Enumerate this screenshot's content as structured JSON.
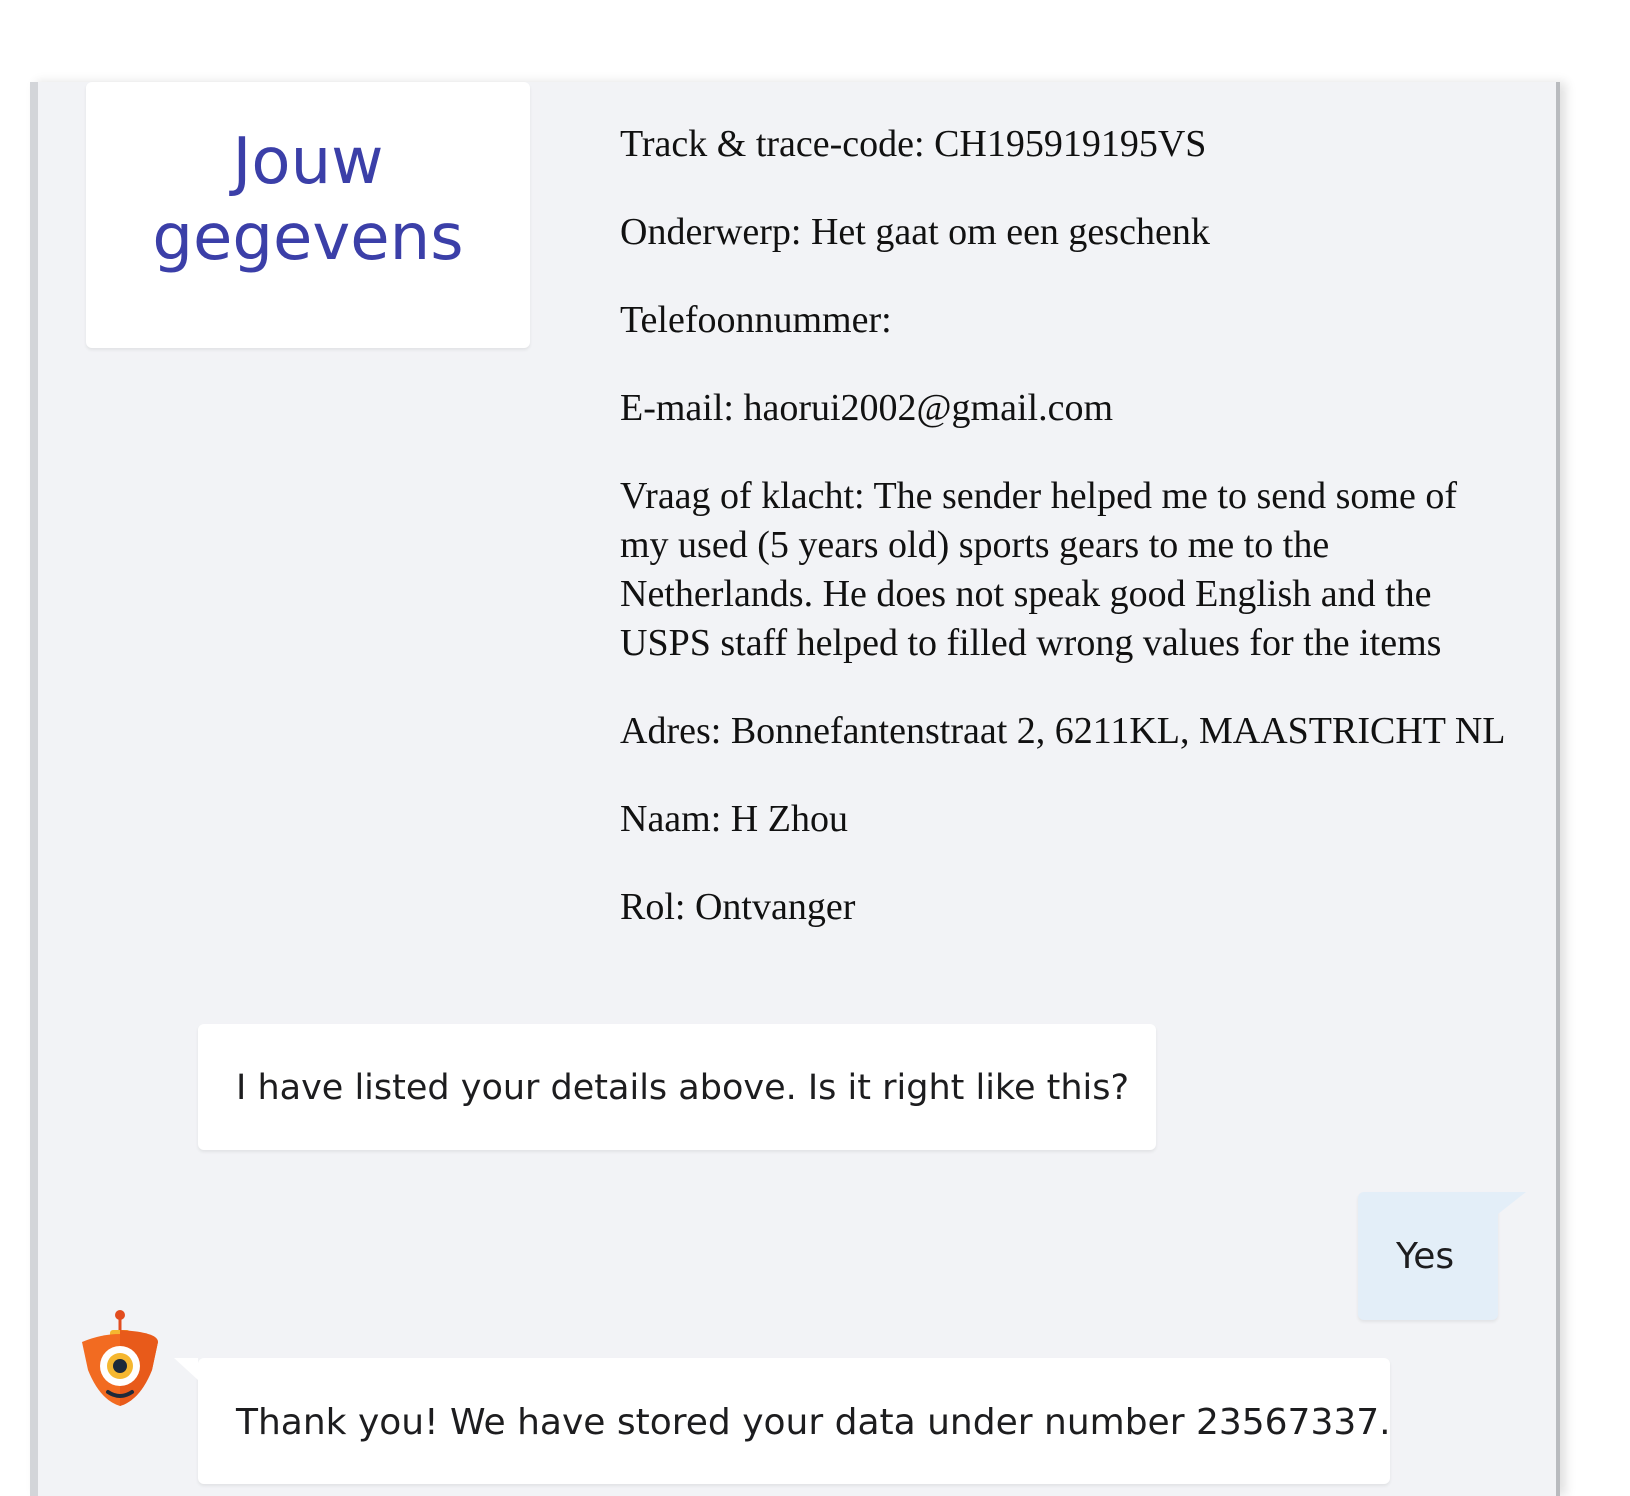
{
  "details": {
    "title": "Jouw gegevens",
    "fields": [
      {
        "label": "Track & trace-code:",
        "value": "CH195919195VS"
      },
      {
        "label": "Onderwerp:",
        "value": "Het gaat om een geschenk"
      },
      {
        "label": "Telefoonnummer:",
        "value": ""
      },
      {
        "label": "E-mail:",
        "value": "haorui2002@gmail.com"
      },
      {
        "label": "Vraag of klacht:",
        "value": "The sender helped me to send some of my used (5 years old) sports gears to me to the Netherlands. He does not speak good English and the USPS staff helped to filled wrong values for the items"
      },
      {
        "label": "Adres:",
        "value": "Bonnefantenstraat 2, 6211KL, MAASTRICHT NL"
      },
      {
        "label": "Naam:",
        "value": "H Zhou"
      },
      {
        "label": "Rol:",
        "value": "Ontvanger"
      }
    ]
  },
  "messages": {
    "bot_question": "I have listed your details above. Is it right like this?",
    "user_reply": "Yes",
    "bot_confirmation": "Thank you! We have stored your data under number 23567337."
  },
  "bot_avatar": {
    "icon": "bot-mascot-icon"
  },
  "colors": {
    "panel_bg": "#f2f3f6",
    "title_color": "#3b3fa8",
    "user_bubble": "#e3eef8",
    "avatar_orange": "#f26b21"
  }
}
